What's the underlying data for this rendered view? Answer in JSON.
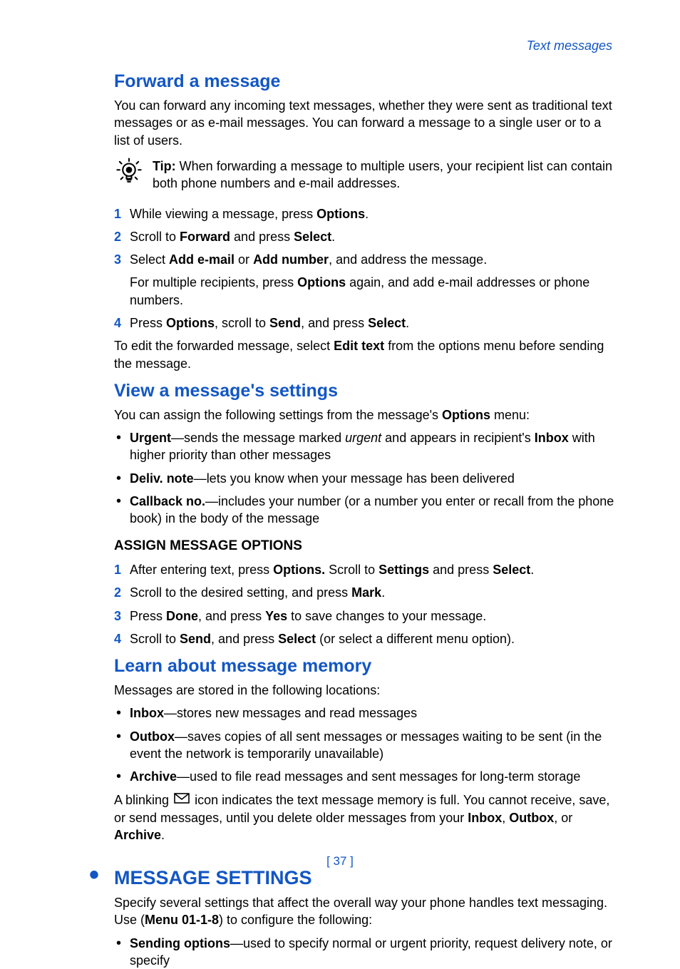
{
  "header": {
    "section": "Text messages"
  },
  "forward": {
    "title": "Forward a message",
    "intro": "You can forward any incoming text messages, whether they were sent as traditional text messages or as e-mail messages. You can forward a message to a single user or to a list of users.",
    "tip_label": "Tip:",
    "tip_body": " When forwarding a message to multiple users, your recipient list can contain both phone numbers and e-mail addresses.",
    "steps": [
      {
        "pre": "While viewing a message, press ",
        "b1": "Options",
        "post": "."
      },
      {
        "pre": "Scroll to ",
        "b1": "Forward",
        "mid": " and press ",
        "b2": "Select",
        "post": "."
      },
      {
        "pre": "Select ",
        "b1": "Add e-mail",
        "mid": " or ",
        "b2": "Add number",
        "post": ", and address the message.",
        "sub_pre": "For multiple recipients, press ",
        "sub_b": "Options",
        "sub_post": " again, and add e-mail addresses or phone numbers."
      },
      {
        "pre": "Press ",
        "b1": "Options",
        "mid": ", scroll to ",
        "b2": "Send",
        "mid2": ", and press ",
        "b3": "Select",
        "post": "."
      }
    ],
    "closing_pre": "To edit the forwarded message, select ",
    "closing_b": "Edit text",
    "closing_post": " from the options menu before sending the message."
  },
  "view": {
    "title": "View a message's settings",
    "intro_pre": "You can assign the following settings from the message's ",
    "intro_b": "Options",
    "intro_post": " menu:",
    "bullets": [
      {
        "b": "Urgent",
        "mid1": "—sends the message marked ",
        "i": "urgent",
        "mid2": " and appears in recipient's ",
        "b2": "Inbox",
        "post": " with higher priority than other messages"
      },
      {
        "b": "Deliv. note",
        "post": "—lets you know when your message has been delivered"
      },
      {
        "b": "Callback no.",
        "post": "—includes your number (or a number you enter or recall from the phone book) in the body of the message"
      }
    ]
  },
  "assign": {
    "title": "ASSIGN MESSAGE OPTIONS",
    "steps": [
      {
        "pre": "After entering text, press ",
        "b1": "Options.",
        "mid": " Scroll to ",
        "b2": "Settings",
        "mid2": " and press ",
        "b3": "Select",
        "post": "."
      },
      {
        "pre": "Scroll to the desired setting, and press ",
        "b1": "Mark",
        "post": "."
      },
      {
        "pre": "Press ",
        "b1": "Done",
        "mid": ", and press ",
        "b2": "Yes",
        "post": " to save changes to your message."
      },
      {
        "pre": "Scroll to ",
        "b1": "Send",
        "mid": ", and press ",
        "b2": "Select",
        "post": " (or select a different menu option)."
      }
    ]
  },
  "memory": {
    "title": "Learn about message memory",
    "intro": "Messages are stored in the following locations:",
    "bullets": [
      {
        "b": "Inbox",
        "post": "—stores new messages and read messages"
      },
      {
        "b": "Outbox",
        "post": "—saves copies of all sent messages or messages waiting to be sent (in the event the network is temporarily unavailable)"
      },
      {
        "b": "Archive",
        "post": "—used to file read messages and sent messages for long-term storage"
      }
    ],
    "closing_pre": "A blinking ",
    "closing_mid": " icon indicates the text message memory is full. You cannot receive, save, or send messages, until you delete older messages from your ",
    "closing_b1": "Inbox",
    "closing_sep1": ", ",
    "closing_b2": "Outbox",
    "closing_sep2": ", or ",
    "closing_b3": "Archive",
    "closing_post": "."
  },
  "settings": {
    "title": "MESSAGE SETTINGS",
    "intro_pre": "Specify several settings that affect the overall way your phone handles text messaging. Use (",
    "intro_b": "Menu 01-1-8",
    "intro_post": ") to configure the following:",
    "bullets": [
      {
        "b": "Sending options",
        "post": "—used to specify normal or urgent priority, request delivery note, or specify"
      }
    ]
  },
  "pagenum": "[ 37 ]"
}
